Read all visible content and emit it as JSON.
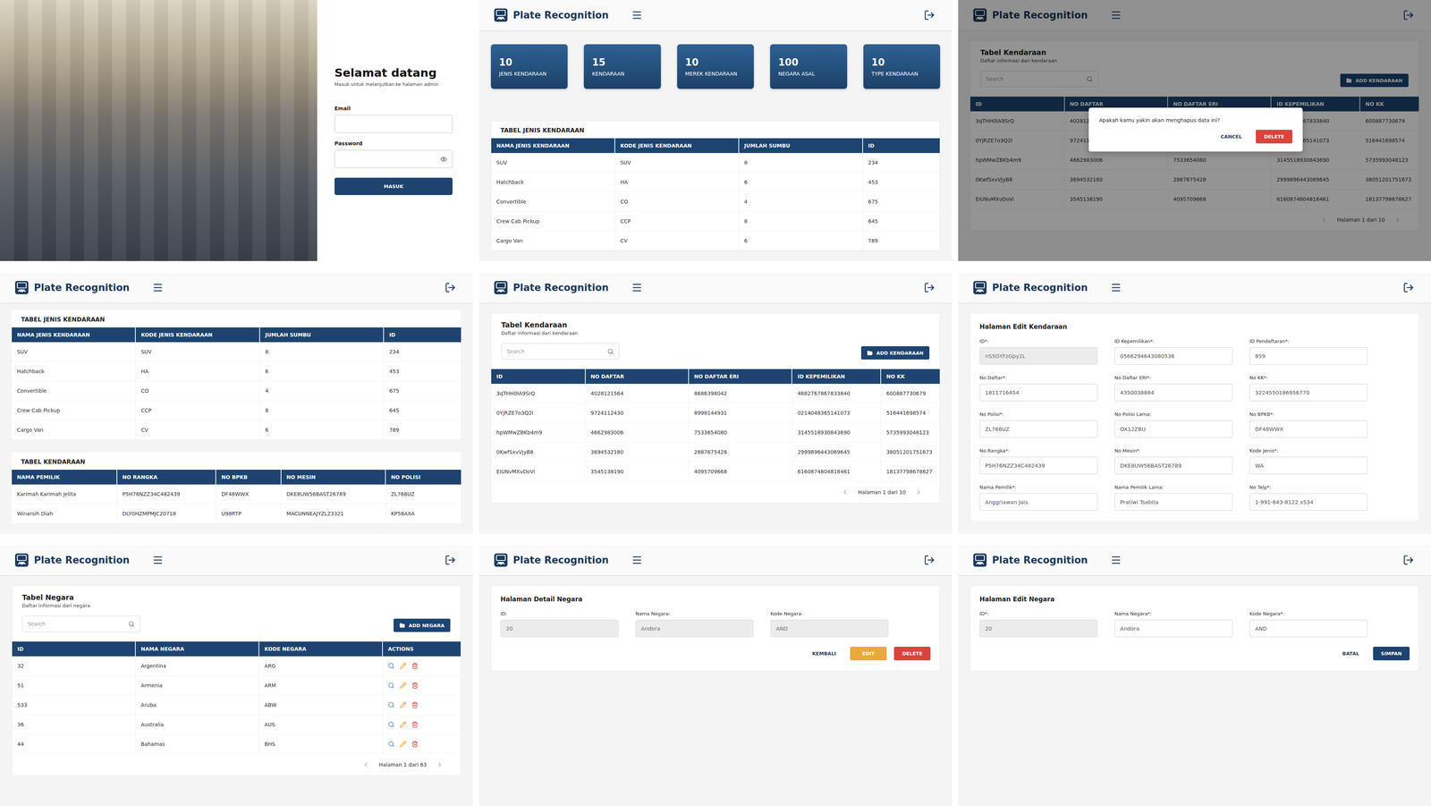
{
  "app": {
    "title": "Plate Recognition"
  },
  "login": {
    "title": "Selamat datang",
    "subtitle": "Masuk untuk melanjutkan ke halaman admin",
    "fields": [
      {
        "label": "Email",
        "value": "",
        "kind": "text"
      },
      {
        "label": "Password",
        "value": "",
        "kind": "password"
      }
    ],
    "button": "MASUK"
  },
  "dashboard": {
    "stats": [
      {
        "value": "10",
        "label": "JENIS KENDARAAN"
      },
      {
        "value": "15",
        "label": "KENDARAAN"
      },
      {
        "value": "10",
        "label": "MEREK KENDARAAN"
      },
      {
        "value": "100",
        "label": "NEGARA ASAL"
      },
      {
        "value": "10",
        "label": "TYPE KENDARAAN"
      }
    ],
    "vehicle_types": {
      "title": "TABEL JENIS KENDARAAN",
      "columns": [
        "NAMA JENIS KENDARAAN",
        "KODE JENIS KENDARAAN",
        "JUMLAH SUMBU",
        "ID"
      ],
      "rows": [
        [
          "SUV",
          "SUV",
          "8",
          "234"
        ],
        [
          "Hatchback",
          "HA",
          "6",
          "453"
        ],
        [
          "Convertible",
          "CO",
          "4",
          "675"
        ],
        [
          "Crew Cab Pickup",
          "CCP",
          "8",
          "645"
        ],
        [
          "Cargo Van",
          "CV",
          "6",
          "789"
        ]
      ]
    },
    "vehicles": {
      "title": "TABEL KENDARAAN",
      "columns": [
        "NAMA PEMILIK",
        "NO RANGKA",
        "NO BPKB",
        "NO MESIN",
        "NO POLISI"
      ],
      "rows": [
        [
          "Karimah Karimah Jelita",
          "P5H76NZZ34C482439",
          "DF48WWX",
          "DKE8UW56BAST26789",
          "ZL768UZ"
        ],
        [
          "Winarsih Diah",
          "DLY0HZMPMJC20718",
          "U98RTP",
          "MACUNNEAJYZL23321",
          "KP58AXA"
        ]
      ]
    }
  },
  "vehicle_list": {
    "title": "Tabel Kendaraan",
    "subtitle": "Daftar informasi dari kendaraan",
    "search": {
      "placeholder": "Search"
    },
    "add_button": "ADD KENDARAAN",
    "columns": [
      "ID",
      "NO DAFTAR",
      "NO DAFTAR ERI",
      "ID KEPEMILIKAN",
      "NO KK"
    ],
    "rows": [
      [
        "3qTHH0IA9SrQ",
        "4028121564",
        "8686398042",
        "4682767867833840",
        "600887730679"
      ],
      [
        "0YjRZE7o3Q2I",
        "9724112430",
        "8998144931",
        "0214048365141073",
        "516441698574"
      ],
      [
        "hpWMwZBKb4m9",
        "4662983006",
        "7533654080",
        "3145518930843690",
        "5735993048123"
      ],
      [
        "0KwfSxvVjyB8",
        "3694532180",
        "2887675428",
        "2999896443069645",
        "38051201751673"
      ],
      [
        "EIUNvMXvDoVi",
        "3545138190",
        "4095709668",
        "6160874804818461",
        "18137798678627"
      ]
    ],
    "pagination": "Halaman 1 dari 10"
  },
  "delete_dialog": {
    "message": "Apakah kamu yakin akan menghapus data ini?",
    "buttons": [
      {
        "label": "CANCEL",
        "kind": "text"
      },
      {
        "label": "DELETE",
        "kind": "danger"
      }
    ]
  },
  "vehicle_edit": {
    "title": "Halaman Edit Kendaraan",
    "fields": [
      {
        "label": "ID*:",
        "value": "nS5GYFzGpy2L",
        "disabled": true
      },
      {
        "label": "ID Kepemilikan*:",
        "value": "0566294643080536",
        "disabled": false
      },
      {
        "label": "ID Pendaftaran*:",
        "value": "859",
        "disabled": false
      },
      {
        "label": "No Daftar*:",
        "value": "1811716454",
        "disabled": false
      },
      {
        "label": "No Daftar ERI*:",
        "value": "4350038884",
        "disabled": false
      },
      {
        "label": "No KK*:",
        "value": "3224550186956770",
        "disabled": false
      },
      {
        "label": "No Polisi*:",
        "value": "ZL768UZ",
        "disabled": false
      },
      {
        "label": "No Polisi Lama:",
        "value": "OX12ZBU",
        "disabled": false
      },
      {
        "label": "No BPKB*:",
        "value": "DF48WWX",
        "disabled": false
      },
      {
        "label": "No Rangka*:",
        "value": "P5H76NZZ34C482439",
        "disabled": false
      },
      {
        "label": "No Mesin*:",
        "value": "DKE8UW56BAST26789",
        "disabled": false
      },
      {
        "label": "Kode Jenis*:",
        "value": "WA",
        "disabled": false
      },
      {
        "label": "Nama Pemilik*:",
        "value": "Anggriawan Jais",
        "disabled": false
      },
      {
        "label": "Nama Pemilik Lama:",
        "value": "Pratiwi Tsabita",
        "disabled": false
      },
      {
        "label": "No Telp*:",
        "value": "1-991-843-8122 x534",
        "disabled": false
      }
    ]
  },
  "country_list": {
    "title": "Tabel Negara",
    "subtitle": "Daftar informasi dari negara",
    "search": {
      "placeholder": "Search"
    },
    "add_button": "ADD NEGARA",
    "columns": [
      "ID",
      "NAMA NEGARA",
      "KODE NEGARA",
      "ACTIONS"
    ],
    "rows": [
      [
        "32",
        "Argentina",
        "ARG"
      ],
      [
        "51",
        "Armenia",
        "ARM"
      ],
      [
        "533",
        "Aruba",
        "ABW"
      ],
      [
        "36",
        "Australia",
        "AUS"
      ],
      [
        "44",
        "Bahamas",
        "BHS"
      ]
    ],
    "pagination": "Halaman 1 dari 63"
  },
  "country_detail": {
    "title": "Halaman Detail Negara",
    "fields": [
      {
        "label": "ID:",
        "value": "20",
        "disabled": true
      },
      {
        "label": "Nama Negara:",
        "value": "Andora",
        "disabled": true
      },
      {
        "label": "Kode Negara:",
        "value": "AND",
        "disabled": true
      }
    ],
    "buttons": [
      {
        "label": "KEMBALI",
        "kind": "text"
      },
      {
        "label": "EDIT",
        "kind": "warning"
      },
      {
        "label": "DELETE",
        "kind": "danger"
      }
    ]
  },
  "country_edit": {
    "title": "Halaman Edit Negara",
    "fields": [
      {
        "label": "ID*:",
        "value": "20",
        "disabled": true
      },
      {
        "label": "Nama Negara*:",
        "value": "Andora",
        "disabled": false
      },
      {
        "label": "Kode Negara*:",
        "value": "AND",
        "disabled": false
      }
    ],
    "buttons": [
      {
        "label": "BATAL",
        "kind": "text"
      },
      {
        "label": "SIMPAN",
        "kind": "primary"
      }
    ]
  }
}
